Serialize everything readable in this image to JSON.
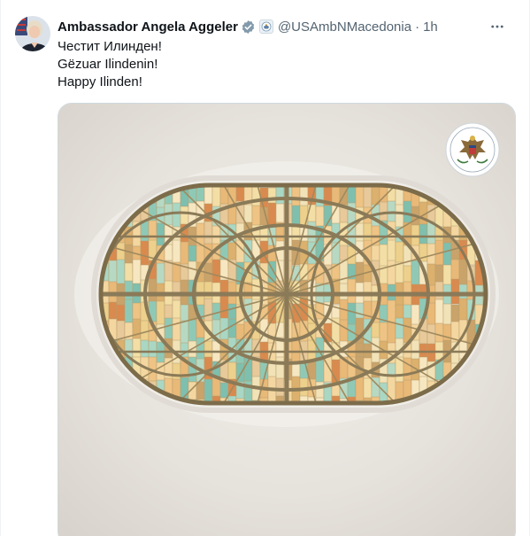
{
  "tweet": {
    "display_name": "Ambassador Angela Aggeler",
    "handle": "@USAmbNMacedonia",
    "separator": "·",
    "time": "1h",
    "lines": [
      "Честит Илинден!",
      "Gëzuar Ilindenin!",
      "Happy Ilinden!"
    ],
    "icons": {
      "verified": "verified-badge-icon",
      "affiliate": "affiliate-badge-icon",
      "more": "more-options-icon"
    }
  },
  "colors": {
    "text_primary": "#0f1419",
    "text_secondary": "#536471",
    "verified_gray": "#829aab",
    "border": "#cfd9de",
    "wall": "#ece9e4"
  }
}
